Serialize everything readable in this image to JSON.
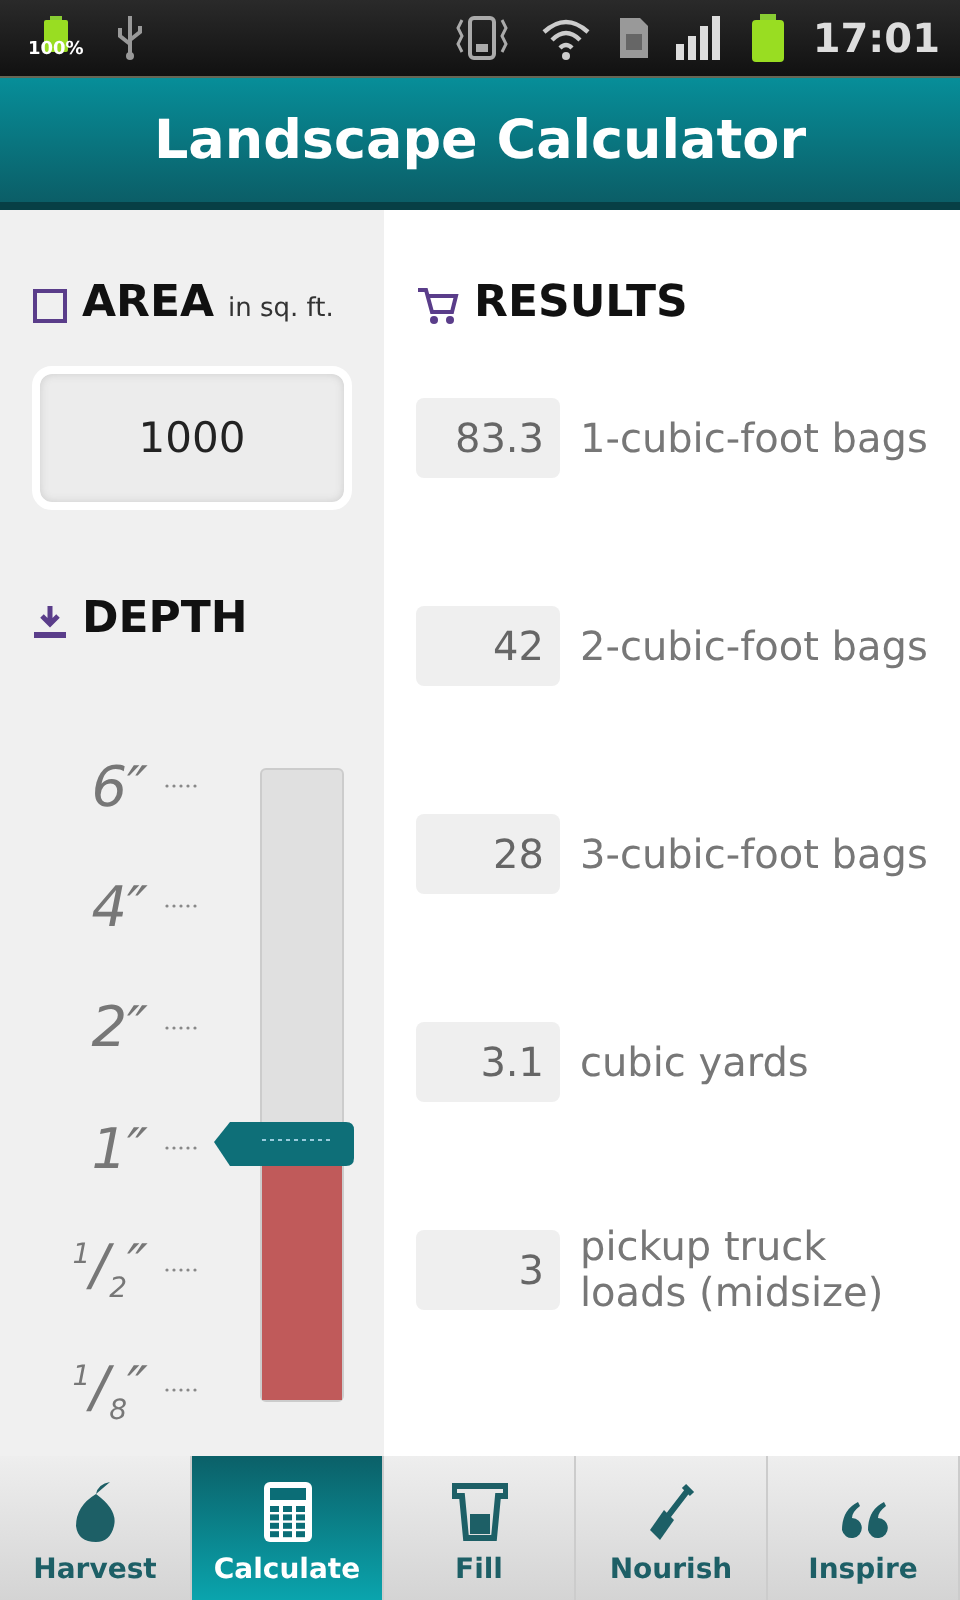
{
  "status_bar": {
    "battery_percent": "100%",
    "time": "17:01"
  },
  "title": "Landscape Calculator",
  "area": {
    "label": "AREA",
    "unit": "in sq. ft.",
    "value": "1000"
  },
  "depth": {
    "label": "DEPTH",
    "level": 0.41,
    "ticks": [
      {
        "label": "6″"
      },
      {
        "label": "4″"
      },
      {
        "label": "2″"
      },
      {
        "label": "1″"
      },
      {
        "label": "$^{1}$/$_{2}$″"
      },
      {
        "label": "$^{1}$/$_{8}$″"
      }
    ]
  },
  "results": {
    "label": "RESULTS",
    "rows": [
      {
        "value": "83.3",
        "label": "1-cubic-foot bags"
      },
      {
        "value": "42",
        "label": "2-cubic-foot bags"
      },
      {
        "value": "28",
        "label": "3-cubic-foot bags"
      },
      {
        "value": "3.1",
        "label": "cubic yards"
      },
      {
        "value": "3",
        "label": "pickup truck loads (midsize)"
      }
    ]
  },
  "nav": [
    {
      "label": "Harvest",
      "selected": false
    },
    {
      "label": "Calculate",
      "selected": true
    },
    {
      "label": "Fill",
      "selected": false
    },
    {
      "label": "Nourish",
      "selected": false
    },
    {
      "label": "Inspire",
      "selected": false
    }
  ]
}
